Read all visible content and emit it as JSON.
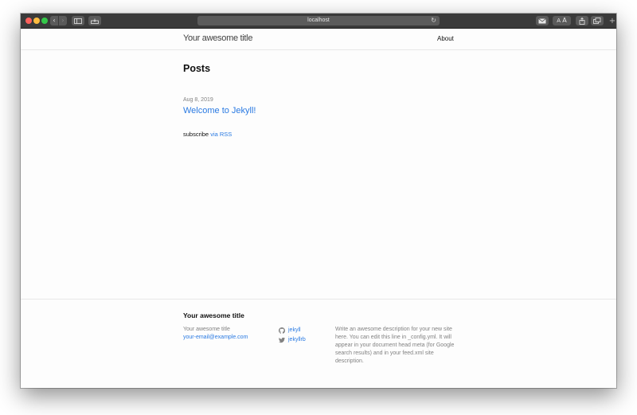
{
  "browser": {
    "url": "localhost"
  },
  "header": {
    "site_title": "Your awesome title",
    "nav": [
      "About"
    ]
  },
  "main": {
    "heading": "Posts",
    "posts": [
      {
        "date": "Aug 8, 2019",
        "title": "Welcome to Jekyll!"
      }
    ],
    "subscribe_text": "subscribe",
    "subscribe_link": "via RSS"
  },
  "footer": {
    "heading": "Your awesome title",
    "name": "Your awesome title",
    "email": "your-email@example.com",
    "social": [
      {
        "icon": "github-icon",
        "label": "jekyll"
      },
      {
        "icon": "twitter-icon",
        "label": "jekyllrb"
      }
    ],
    "description": "Write an awesome description for your new site here. You can edit this line in _config.yml. It will appear in your document head meta (for Google search results) and in your feed.xml site description."
  },
  "colors": {
    "link": "#2a7ae2",
    "text": "#111111",
    "muted": "#828282",
    "toolbar": "#3a3a3a"
  }
}
